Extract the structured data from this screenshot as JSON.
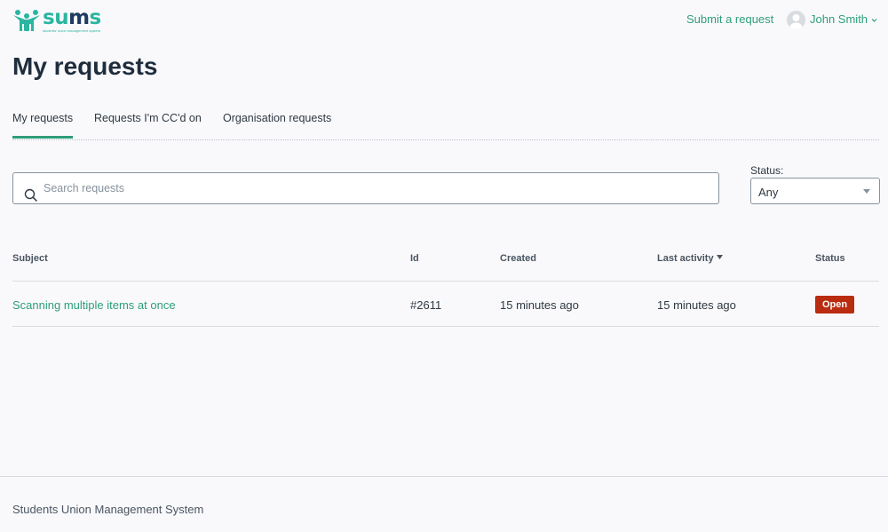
{
  "brand": {
    "name_prefix": "s",
    "name_highlight": "u",
    "name_mid": "m",
    "name_suffix": "s",
    "tagline": "students' union management system",
    "colors": {
      "primary": "#2cb5a0",
      "dark": "#1e3a5f"
    }
  },
  "header": {
    "submit_request": "Submit a request",
    "user_name": "John Smith"
  },
  "page": {
    "title": "My requests"
  },
  "tabs": [
    {
      "label": "My requests",
      "active": true
    },
    {
      "label": "Requests I'm CC'd on",
      "active": false
    },
    {
      "label": "Organisation requests",
      "active": false
    }
  ],
  "search": {
    "placeholder": "Search requests",
    "value": ""
  },
  "status_filter": {
    "label": "Status:",
    "selected": "Any"
  },
  "table": {
    "columns": {
      "subject": "Subject",
      "id": "Id",
      "created": "Created",
      "last_activity": "Last activity",
      "status": "Status"
    },
    "rows": [
      {
        "subject": "Scanning multiple items at once",
        "id": "#2611",
        "created": "15 minutes ago",
        "last_activity": "15 minutes ago",
        "status": "Open"
      }
    ]
  },
  "footer": {
    "text": "Students Union Management System"
  },
  "colors": {
    "accent": "#2e9e78",
    "status_open": "#b92c0f"
  }
}
